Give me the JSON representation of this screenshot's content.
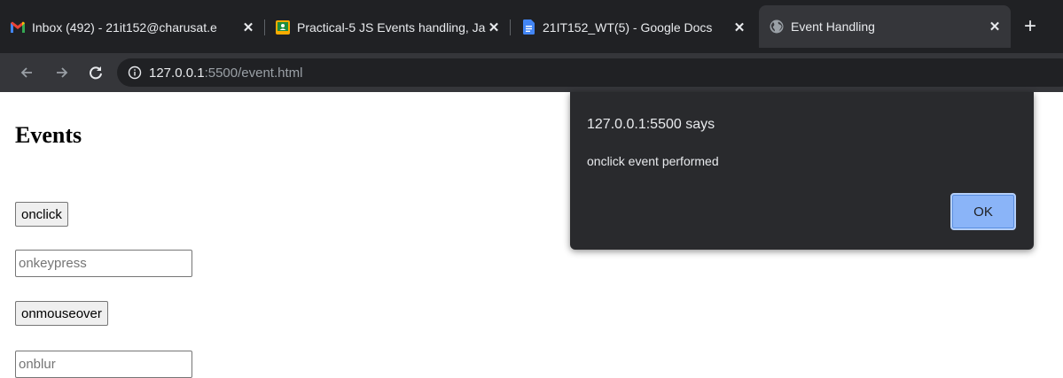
{
  "browser": {
    "tabs": [
      {
        "title": "Inbox (492) - 21it152@charusat.e",
        "icon": "gmail-icon"
      },
      {
        "title": "Practical-5 JS Events handling, Ja",
        "icon": "classroom-icon"
      },
      {
        "title": "21IT152_WT(5) - Google Docs",
        "icon": "docs-icon"
      },
      {
        "title": "Event Handling",
        "icon": "globe-icon"
      }
    ],
    "url_host": "127.0.0.1",
    "url_path": ":5500/event.html"
  },
  "page": {
    "title": "Events",
    "onclick_label": "onclick",
    "onkeypress_placeholder": "onkeypress",
    "onmouseover_label": "onmouseover",
    "onblur_placeholder": "onblur"
  },
  "dialog": {
    "origin": "127.0.0.1:5500 says",
    "message": "onclick event performed",
    "ok_label": "OK"
  },
  "colors": {
    "gmail_red": "#ea4335",
    "classroom_yellow": "#f9ab00",
    "docs_blue": "#4285f4",
    "ok_blue": "#8ab4f8"
  }
}
